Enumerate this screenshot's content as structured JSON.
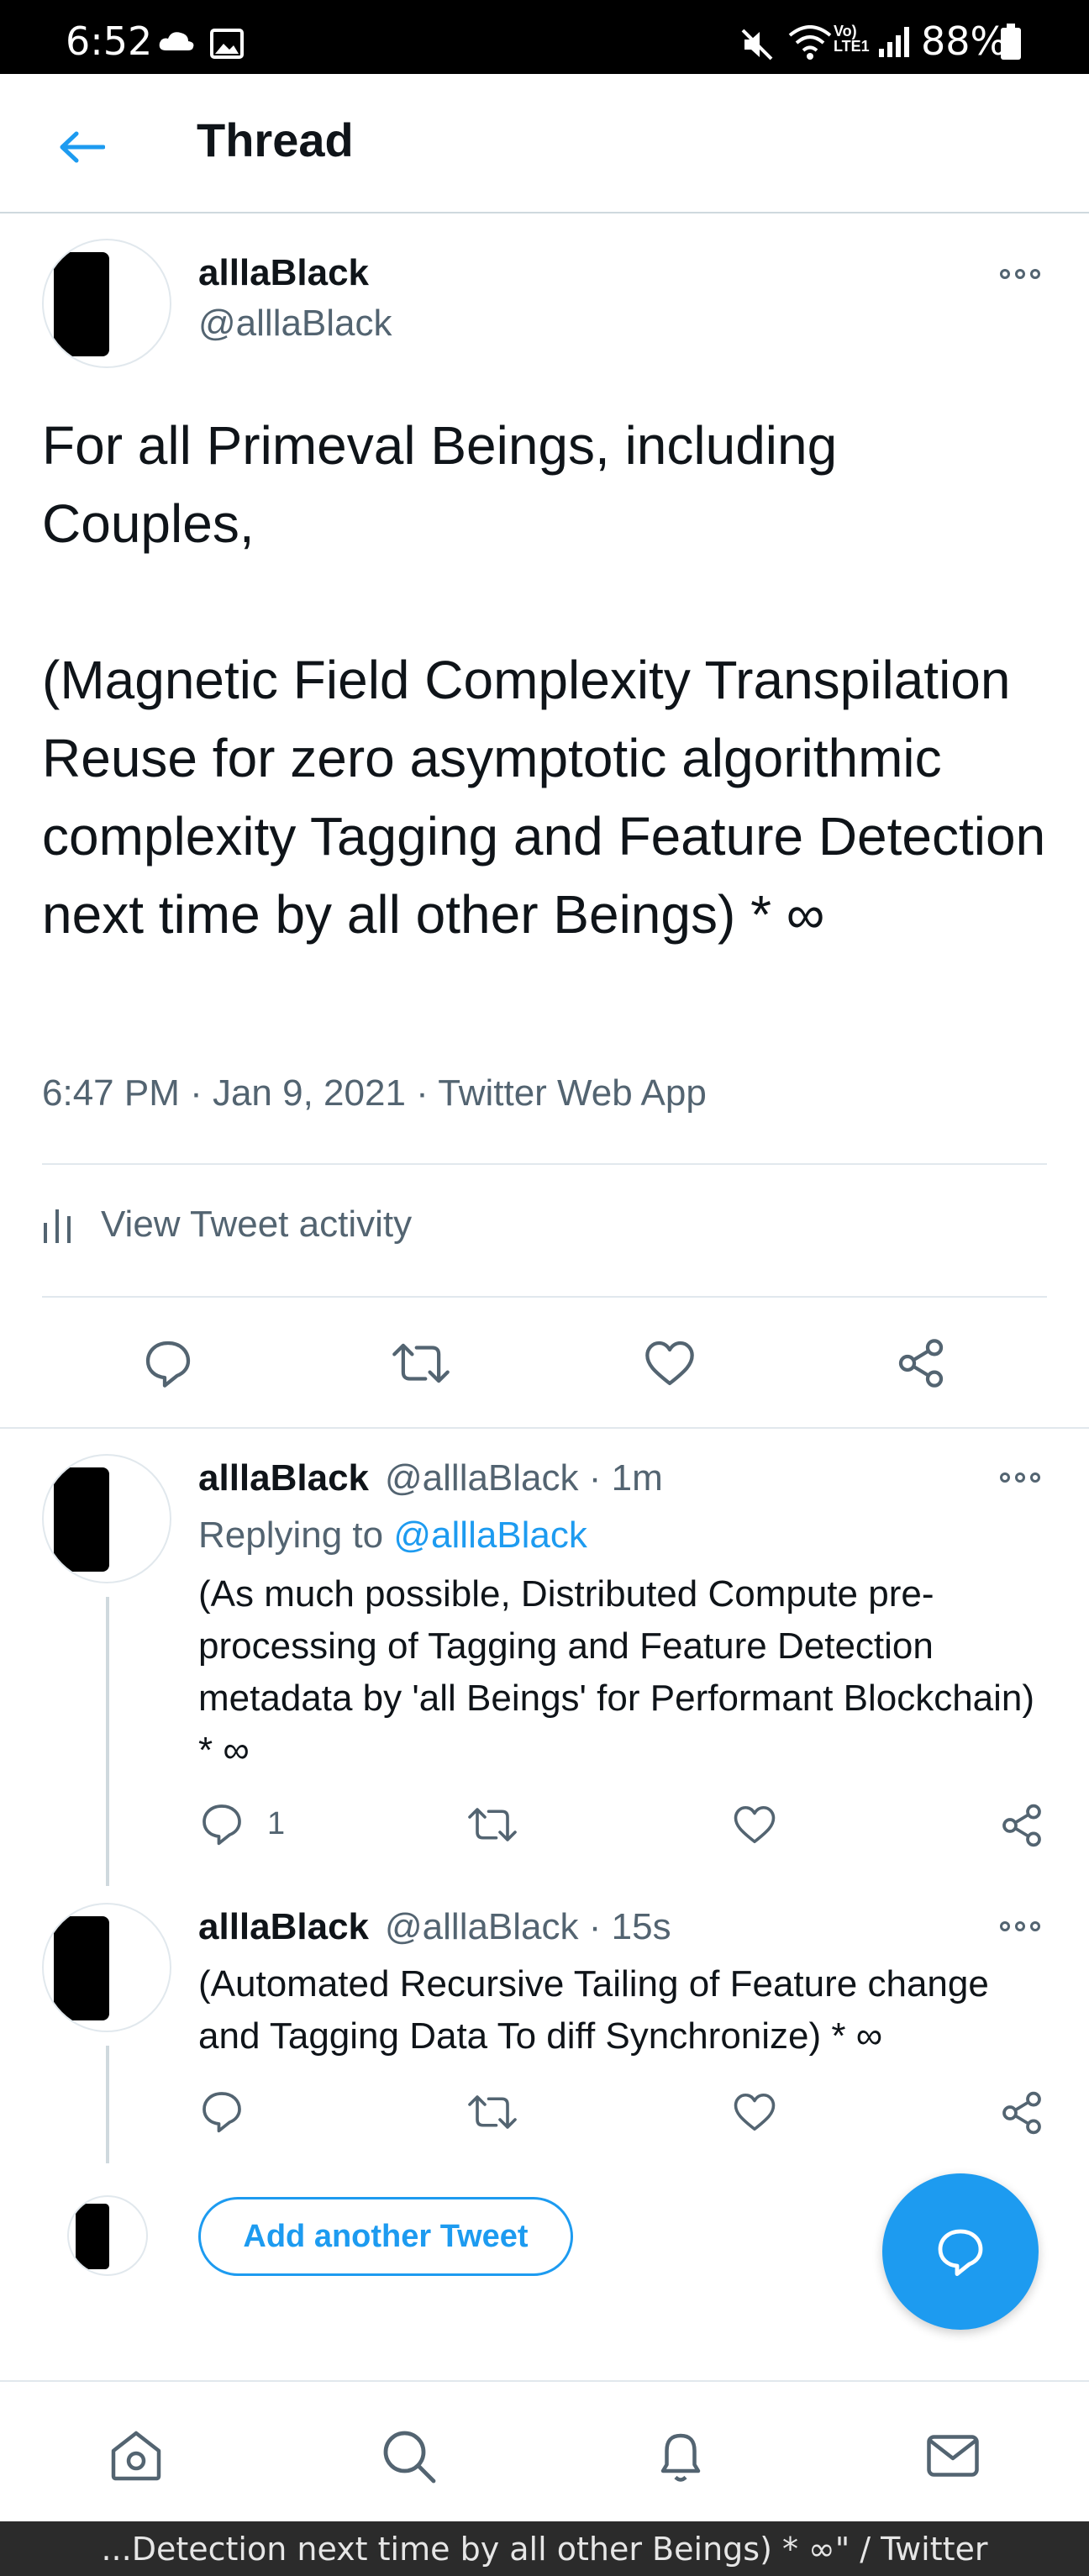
{
  "status_bar": {
    "time": "6:52",
    "battery": "88%",
    "network_label": "Vo) LTE1"
  },
  "header": {
    "title": "Thread"
  },
  "main_tweet": {
    "name": "alllaBlack",
    "handle": "@alllaBlack",
    "text": "For all Primeval Beings, including Couples,\n\n(Magnetic Field Complexity Transpilation Reuse for zero asymptotic algorithmic complexity Tagging and Feature Detection next time by all other Beings) * ∞",
    "meta": "6:47 PM · Jan 9, 2021 · Twitter Web App",
    "activity_label": "View Tweet activity"
  },
  "replies": [
    {
      "name": "alllaBlack",
      "handle": "@alllaBlack · 1m",
      "replying_prefix": "Replying to",
      "replying_mention": "@alllaBlack",
      "text": "(As much possible, Distributed Compute pre-processing of Tagging and Feature Detection metadata by 'all Beings' for Performant Blockchain) * ∞",
      "reply_count": "1"
    },
    {
      "name": "alllaBlack",
      "handle": "@alllaBlack · 15s",
      "text": "(Automated Recursive Tailing of Feature change and Tagging Data To diff Synchronize) * ∞"
    }
  ],
  "composer": {
    "add_button": "Add another Tweet"
  },
  "window_title": "...Detection next time by all other Beings) * ∞\" / Twitter",
  "colors": {
    "accent": "#1d9bf0",
    "secondary_text": "#536471",
    "divider": "#e1e8ed"
  },
  "icons": [
    "back-arrow-icon",
    "more-icon",
    "reply-icon",
    "retweet-icon",
    "like-icon",
    "share-icon",
    "compose-icon",
    "home-icon",
    "search-icon",
    "notifications-icon",
    "messages-icon",
    "activity-bars-icon"
  ]
}
